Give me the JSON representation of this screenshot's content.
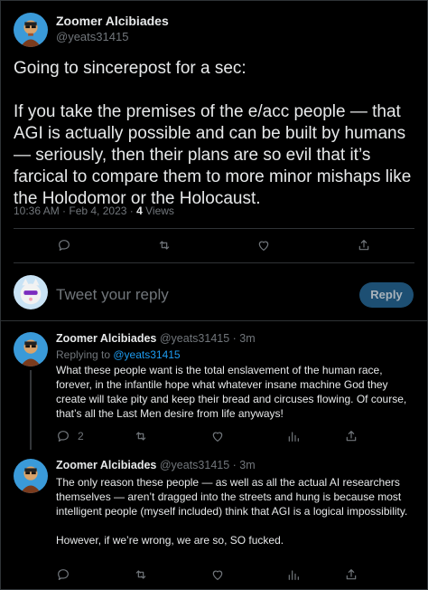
{
  "main_tweet": {
    "author_name": "Zoomer Alcibiades",
    "author_handle": "@yeats31415",
    "text_para1": "Going to sincerepost for a sec:",
    "text_para2": "If you take the premises of the e/acc people — that AGI is actually possible and can be built by humans — seriously, then their plans are so evil that it’s farcical to compare them to more minor mishaps like the Holodomor or the Holocaust.",
    "timestamp": "10:36 AM · Feb 4, 2023",
    "separator": " · ",
    "views_count": "4",
    "views_label": " Views",
    "actions": {
      "reply_icon": "reply-icon",
      "retweet_icon": "retweet-icon",
      "like_icon": "heart-icon",
      "share_icon": "share-icon"
    }
  },
  "reply_composer": {
    "placeholder": "Tweet your reply",
    "button_label": "Reply",
    "button_color": "#1d4f73"
  },
  "replies": [
    {
      "author_name": "Zoomer Alcibiades",
      "author_handle": "@yeats31415 · 3m",
      "replying_prefix": "Replying to ",
      "replying_to": "@yeats31415",
      "text_para1": "What these people want is the total enslavement of the human race, forever, in the infantile hope what whatever insane machine God they create will take pity and keep their bread and circuses flowing. Of course, that’s all the Last Men desire from life anyways!",
      "reply_count": "2"
    },
    {
      "author_name": "Zoomer Alcibiades",
      "author_handle": "@yeats31415 · 3m",
      "text_para1": "The only reason these people — as well as all the actual AI researchers themselves — aren’t dragged into the streets and hung is because most intelligent people (myself included) think that AGI is a logical impossibility.",
      "text_para2": "However, if we’re wrong, we are so, SO fucked.",
      "reply_count": ""
    }
  ],
  "colors": {
    "background": "#000000",
    "text": "#e7e9ea",
    "muted": "#71767b",
    "link": "#1d9bf0",
    "border": "#2f3336"
  }
}
